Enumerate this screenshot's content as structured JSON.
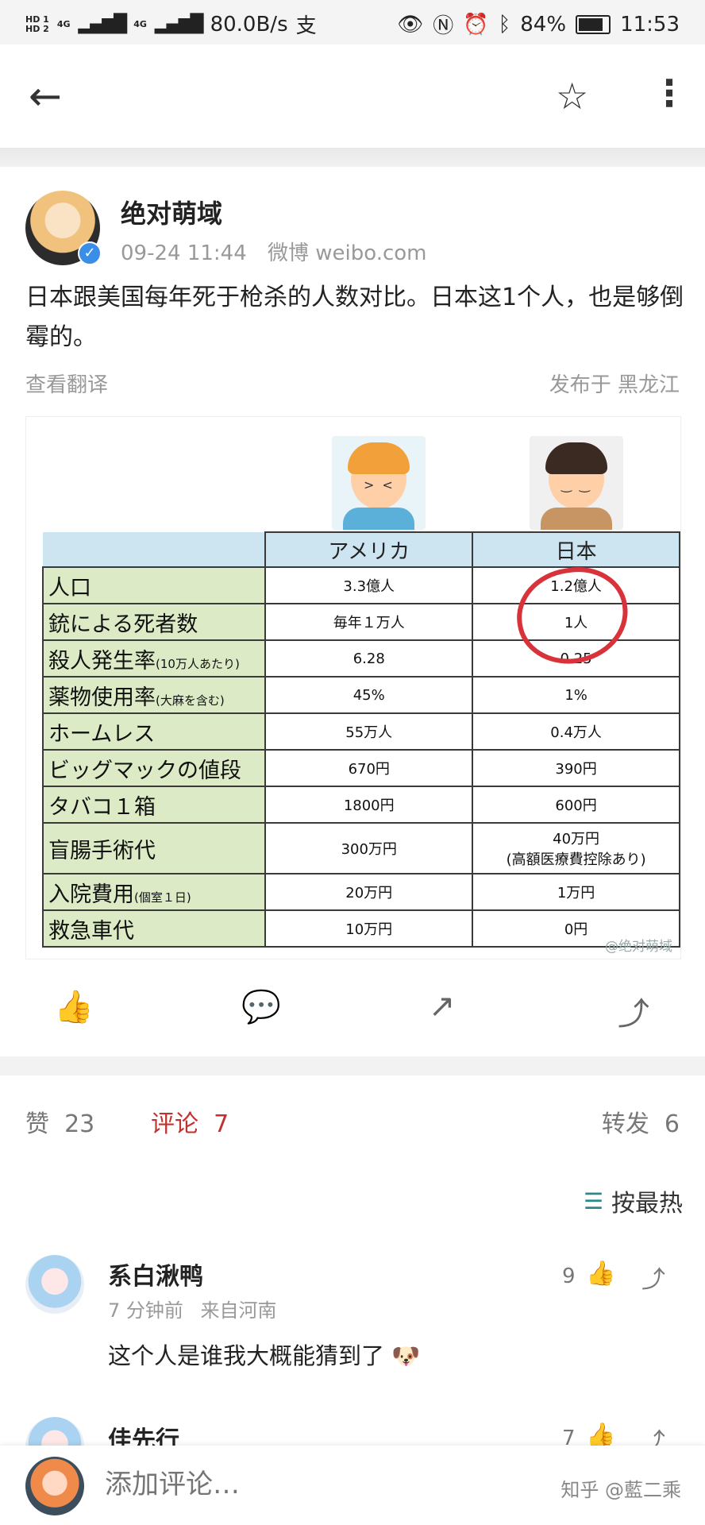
{
  "status": {
    "hd1": "HD 1",
    "hd2": "HD 2",
    "net1": "4G",
    "net2": "4G",
    "speed": "80.0B/s",
    "battery": "84%",
    "time": "11:53"
  },
  "post": {
    "author": "绝对萌域",
    "date": "09-24 11:44",
    "source": "微博 weibo.com",
    "text": "日本跟美国每年死于枪杀的人数对比。日本这1个人，也是够倒霉的。",
    "translate": "查看翻译",
    "location": "发布于 黑龙江"
  },
  "table": {
    "headers": [
      "アメリカ",
      "日本"
    ],
    "rows": [
      {
        "label": "人口",
        "note": "",
        "us": "3.3億人",
        "jp": "1.2億人"
      },
      {
        "label": "銃による死者数",
        "note": "",
        "us": "毎年１万人",
        "jp": "1人"
      },
      {
        "label": "殺人発生率",
        "note": "(10万人あたり)",
        "us": "6.28",
        "jp": "0.25"
      },
      {
        "label": "薬物使用率",
        "note": "(大麻を含む)",
        "us": "45%",
        "jp": "1%"
      },
      {
        "label": "ホームレス",
        "note": "",
        "us": "55万人",
        "jp": "0.4万人"
      },
      {
        "label": "ビッグマックの値段",
        "note": "",
        "us": "670円",
        "jp": "390円"
      },
      {
        "label": "タバコ１箱",
        "note": "",
        "us": "1800円",
        "jp": "600円"
      },
      {
        "label": "盲腸手術代",
        "note": "",
        "us": "300万円",
        "jp": "40万円",
        "jp2": "(高額医療費控除あり)"
      },
      {
        "label": "入院費用",
        "note": "(個室１日)",
        "us": "20万円",
        "jp": "1万円"
      },
      {
        "label": "救急車代",
        "note": "",
        "us": "10万円",
        "jp": "0円"
      }
    ],
    "watermark": "@绝对萌域"
  },
  "stats": {
    "likes_label": "赞",
    "likes": "23",
    "comments_label": "评论",
    "comments": "7",
    "reposts_label": "转发",
    "reposts": "6"
  },
  "sort_label": "按最热",
  "comments": [
    {
      "name": "系白湫鸭",
      "time": "7 分钟前",
      "from": "来自河南",
      "text": "这个人是谁我大概能猜到了",
      "likes": "9"
    },
    {
      "name": "佳先行",
      "likes": "7"
    }
  ],
  "bottom": {
    "placeholder": "添加评论…",
    "watermark": "知乎 @藍二乘"
  },
  "colors": {
    "accent_comment": "#c0322f",
    "verified": "#3b8ee8",
    "table_label_bg": "#dcebc6",
    "table_header_bg": "#cde4f1"
  }
}
